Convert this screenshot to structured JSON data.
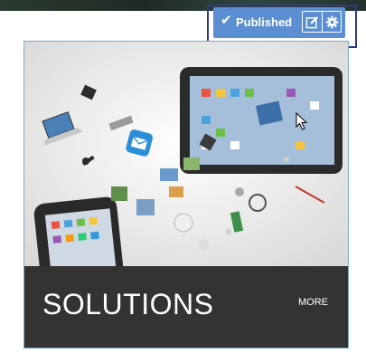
{
  "toolbar": {
    "status_label": "Published",
    "status_icon": "check-icon",
    "edit_icon": "edit-icon",
    "settings_icon": "gear-icon",
    "accent": "#5b8fd1",
    "frame_color": "#2c3a8a"
  },
  "card": {
    "title": "SOLUTIONS",
    "more_label": "MORE",
    "image_icon": "devices-illustration",
    "footer_color": "#333333",
    "border_color": "#7ea6d6"
  }
}
